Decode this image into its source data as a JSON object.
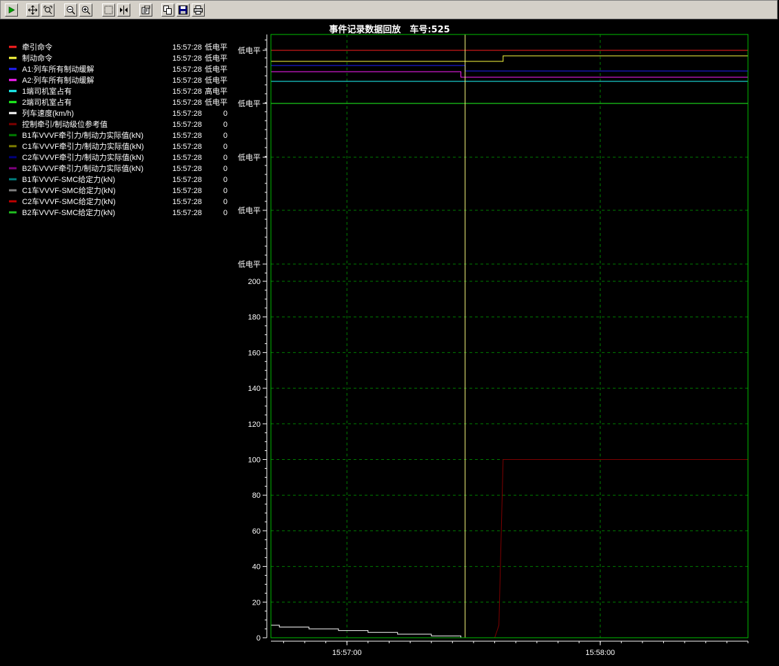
{
  "toolbar": {
    "buttons": [
      {
        "name": "play-button",
        "icon": "play-icon"
      },
      {
        "name": "pan-button",
        "icon": "move-icon"
      },
      {
        "name": "zoom-region-button",
        "icon": "zoom-region-icon"
      },
      {
        "name": "zoom-out-button",
        "icon": "zoom-out-icon"
      },
      {
        "name": "zoom-in-button",
        "icon": "zoom-in-icon"
      },
      {
        "name": "select-rect-button",
        "icon": "select-rect-icon"
      },
      {
        "name": "cursor-line-button",
        "icon": "cursor-line-icon"
      },
      {
        "name": "properties-button",
        "icon": "properties-icon"
      },
      {
        "name": "copy-button",
        "icon": "copy-icon"
      },
      {
        "name": "save-button",
        "icon": "save-icon"
      },
      {
        "name": "print-button",
        "icon": "print-icon"
      }
    ]
  },
  "chart_data": {
    "type": "line",
    "title": "事件记录数据回放　车号:525",
    "colors": {
      "background": "#000000",
      "frame": "#00c000",
      "grid": "#008000",
      "cursor": "#ffff80",
      "tick": "#ffffff"
    },
    "legend": [
      {
        "name": "牵引命令",
        "color": "#ff2020",
        "time": "15:57:28",
        "value": "低电平"
      },
      {
        "name": "制动命令",
        "color": "#ffff40",
        "time": "15:57:28",
        "value": "低电平"
      },
      {
        "name": "A1:列车所有制动缓解",
        "color": "#2020ff",
        "time": "15:57:28",
        "value": "低电平"
      },
      {
        "name": "A2:列车所有制动缓解",
        "color": "#ff20ff",
        "time": "15:57:28",
        "value": "低电平"
      },
      {
        "name": "1端司机室占有",
        "color": "#20ffff",
        "time": "15:57:28",
        "value": "高电平"
      },
      {
        "name": "2端司机室占有",
        "color": "#20ff20",
        "time": "15:57:28",
        "value": "低电平"
      },
      {
        "name": "列车速度(km/h)",
        "color": "#ffffff",
        "time": "15:57:28",
        "value": "0"
      },
      {
        "name": "控制牵引/制动级位参考值",
        "color": "#800000",
        "time": "15:57:28",
        "value": "0"
      },
      {
        "name": "B1车VVVF牵引力/制动力实际值(kN)",
        "color": "#008000",
        "time": "15:57:28",
        "value": "0"
      },
      {
        "name": "C1车VVVF牵引力/制动力实际值(kN)",
        "color": "#808000",
        "time": "15:57:28",
        "value": "0"
      },
      {
        "name": "C2车VVVF牵引力/制动力实际值(kN)",
        "color": "#000080",
        "time": "15:57:28",
        "value": "0"
      },
      {
        "name": "B2车VVVF牵引力/制动力实际值(kN)",
        "color": "#800080",
        "time": "15:57:28",
        "value": "0"
      },
      {
        "name": "B1车VVVF-SMC给定力(kN)",
        "color": "#008080",
        "time": "15:57:28",
        "value": "0"
      },
      {
        "name": "C1车VVVF-SMC给定力(kN)",
        "color": "#808080",
        "time": "15:57:28",
        "value": "0"
      },
      {
        "name": "C2车VVVF-SMC给定力(kN)",
        "color": "#c00000",
        "time": "15:57:28",
        "value": "0"
      },
      {
        "name": "B2车VVVF-SMC给定力(kN)",
        "color": "#20c020",
        "time": "15:57:28",
        "value": "0"
      }
    ],
    "digital_axis_labels": [
      "低电平",
      "低电平",
      "低电平",
      "低电平",
      "低电平"
    ],
    "analog_axis": {
      "ylim": [
        0,
        200
      ],
      "ticks": [
        0,
        20,
        40,
        60,
        80,
        100,
        120,
        140,
        160,
        180,
        200
      ]
    },
    "x_axis": {
      "ticks": [
        "15:57:00",
        "15:58:00"
      ]
    },
    "digital_series": [
      {
        "name": "牵引命令",
        "color": "#ff2020",
        "level": "low",
        "steps": [
          [
            "15:56:42",
            "low"
          ]
        ]
      },
      {
        "name": "制动命令",
        "color": "#ffff40",
        "level": "low",
        "steps": [
          [
            "15:56:42",
            "low"
          ],
          [
            "15:57:37",
            "high"
          ]
        ]
      },
      {
        "name": "A1:列车所有制动缓解",
        "color": "#2020ff",
        "steps": [
          [
            "15:56:42",
            "high"
          ],
          [
            "15:57:28",
            "low"
          ]
        ]
      },
      {
        "name": "A2:列车所有制动缓解",
        "color": "#ff20ff",
        "steps": [
          [
            "15:56:42",
            "high"
          ],
          [
            "15:57:27",
            "low"
          ]
        ]
      },
      {
        "name": "1端司机室占有",
        "color": "#20ffff",
        "steps": [
          [
            "15:56:42",
            "high"
          ]
        ]
      },
      {
        "name": "2端司机室占有",
        "color": "#20ff20",
        "steps": [
          [
            "15:56:42",
            "low"
          ]
        ]
      }
    ],
    "speed_series": {
      "name": "列车速度(km/h)",
      "color": "#ffffff",
      "points": [
        [
          "15:56:42",
          7
        ],
        [
          "15:56:44",
          6
        ],
        [
          "15:56:51",
          5
        ],
        [
          "15:56:58",
          4
        ],
        [
          "15:57:05",
          3
        ],
        [
          "15:57:12",
          2
        ],
        [
          "15:57:20",
          1
        ],
        [
          "15:57:27",
          0
        ],
        [
          "15:58:35",
          0
        ]
      ]
    },
    "reference_series": {
      "name": "控制牵引/制动级位参考值",
      "color": "#800000",
      "points": [
        [
          "15:56:42",
          0
        ],
        [
          "15:57:35",
          0
        ],
        [
          "15:57:36",
          7
        ],
        [
          "15:57:37",
          100
        ],
        [
          "15:58:35",
          100
        ]
      ]
    },
    "cursor_time": "15:57:28"
  }
}
